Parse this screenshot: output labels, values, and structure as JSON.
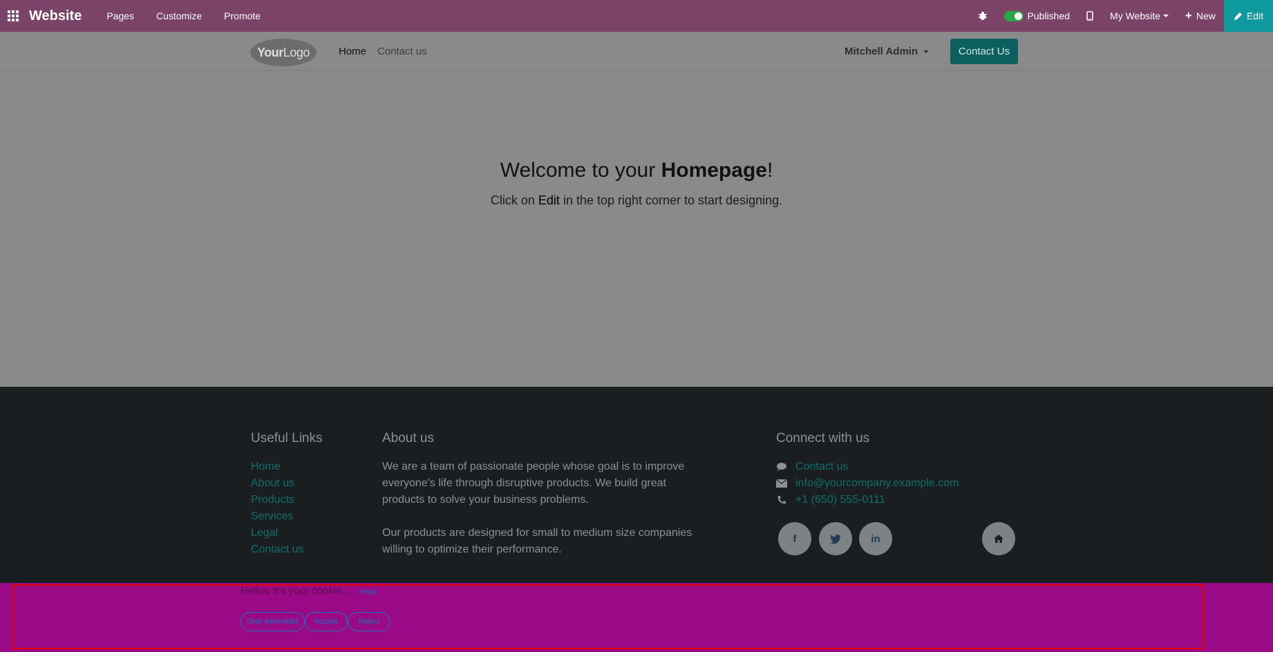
{
  "topbar": {
    "brand": "Website",
    "menu": [
      "Pages",
      "Customize",
      "Promote"
    ],
    "published_label": "Published",
    "website_selector": "My Website",
    "new_label": "New",
    "edit_label": "Edit"
  },
  "header": {
    "logo_text_bold": "Your",
    "logo_text_thin": "Logo",
    "nav": [
      "Home",
      "Contact us"
    ],
    "user": "Mitchell Admin",
    "contact_button": "Contact Us"
  },
  "hero": {
    "title_prefix": "Welcome to your ",
    "title_bold": "Homepage",
    "title_suffix": "!",
    "subtitle_prefix": "Click on ",
    "subtitle_bold": "Edit",
    "subtitle_suffix": " in the top right corner to start designing."
  },
  "footer": {
    "useful_links": {
      "title": "Useful Links",
      "items": [
        "Home",
        "About us",
        "Products",
        "Services",
        "Legal",
        "Contact us"
      ]
    },
    "about": {
      "title": "About us",
      "p1": "We are a team of passionate people whose goal is to improve everyone's life through disruptive products. We build great products to solve your business problems.",
      "p2": "Our products are designed for small to medium size companies willing to optimize their performance."
    },
    "connect": {
      "title": "Connect with us",
      "contact": "Contact us",
      "email": "info@yourcompany.example.com",
      "phone": "+1 (650) 555-0111"
    },
    "social": [
      "f",
      "t",
      "in",
      "home"
    ]
  },
  "cookie": {
    "text": "Helloo It's your cookie.....",
    "read": "Read",
    "buttons": [
      "Only essentials",
      "Accept",
      "Reject"
    ]
  }
}
